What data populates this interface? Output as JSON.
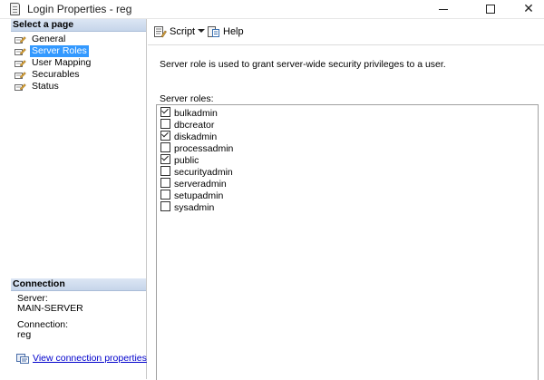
{
  "window": {
    "title": "Login Properties - reg",
    "minimize_glyph": "",
    "maximize_glyph": "",
    "close_glyph": "✕"
  },
  "left_pane": {
    "header": "Select a page",
    "pages": [
      {
        "label": "General",
        "icon": "wrench-page-icon",
        "selected": false
      },
      {
        "label": "Server Roles",
        "icon": "wrench-page-icon",
        "selected": true
      },
      {
        "label": "User Mapping",
        "icon": "wrench-page-icon",
        "selected": false
      },
      {
        "label": "Securables",
        "icon": "wrench-page-icon",
        "selected": false
      },
      {
        "label": "Status",
        "icon": "wrench-page-icon",
        "selected": false
      }
    ],
    "connection": {
      "header": "Connection",
      "server_label": "Server:",
      "server_value": "MAIN-SERVER",
      "connection_label": "Connection:",
      "connection_value": "reg",
      "link_label": "View connection properties"
    }
  },
  "toolbar": {
    "script_label": "Script",
    "help_label": "Help"
  },
  "main": {
    "description": "Server role is used to grant server-wide security privileges to a user.",
    "roles_label": "Server roles:",
    "roles": [
      {
        "name": "bulkadmin",
        "checked": true
      },
      {
        "name": "dbcreator",
        "checked": false
      },
      {
        "name": "diskadmin",
        "checked": true
      },
      {
        "name": "processadmin",
        "checked": false
      },
      {
        "name": "public",
        "checked": true
      },
      {
        "name": "securityadmin",
        "checked": false
      },
      {
        "name": "serveradmin",
        "checked": false
      },
      {
        "name": "setupadmin",
        "checked": false
      },
      {
        "name": "sysadmin",
        "checked": false
      }
    ]
  },
  "colors": {
    "selection": "#3399ff",
    "link": "#0000cc",
    "pane_header": "#c6d5ea"
  }
}
